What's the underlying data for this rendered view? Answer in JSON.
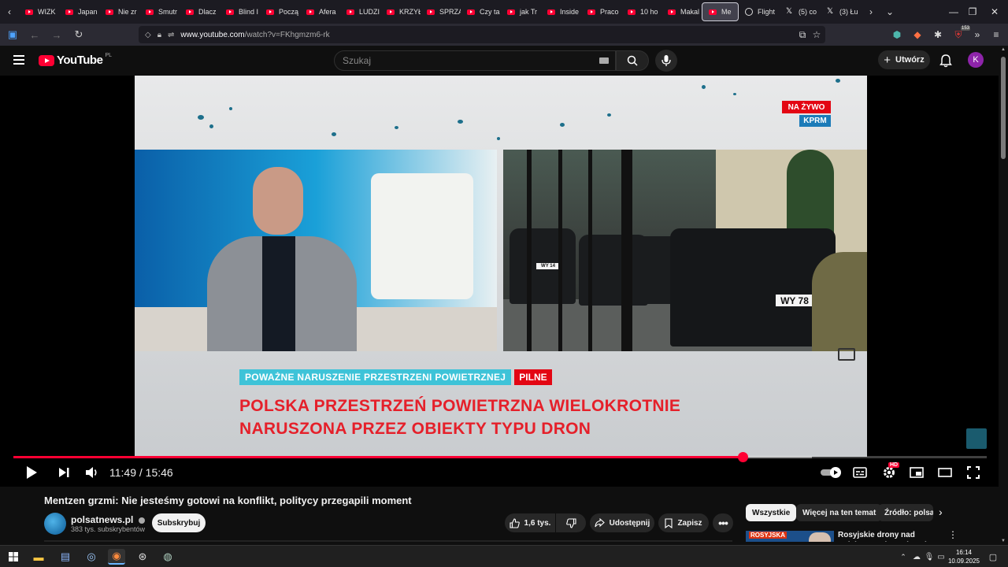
{
  "browser": {
    "tabs": [
      {
        "label": "WIZK"
      },
      {
        "label": "Japan"
      },
      {
        "label": "Nie zr"
      },
      {
        "label": "Smutr"
      },
      {
        "label": "Dlacz"
      },
      {
        "label": "Blind I"
      },
      {
        "label": "Począ"
      },
      {
        "label": "Afera"
      },
      {
        "label": "LUDZI"
      },
      {
        "label": "KRZYŁ"
      },
      {
        "label": "SPRZA"
      },
      {
        "label": "Czy ta"
      },
      {
        "label": "jak Tr"
      },
      {
        "label": "Inside"
      },
      {
        "label": "Praco"
      },
      {
        "label": "10 ho"
      },
      {
        "label": "Makal"
      }
    ],
    "active_tab": {
      "label": "Me"
    },
    "extra_tabs": [
      {
        "label": "Flight",
        "icon": "globe-icon"
      },
      {
        "label": "(5) co",
        "icon": "x-logo-icon"
      },
      {
        "label": "(3) Łu",
        "icon": "x-logo-icon"
      }
    ],
    "url_host": "www.youtube.com",
    "url_path": "/watch?v=FKhgmzm6-rk",
    "ext_badge": "153"
  },
  "youtube": {
    "logo_text": "YouTube",
    "country_code": "PL",
    "search_placeholder": "Szukaj",
    "create_label": "Utwórz",
    "avatar_letter": "K"
  },
  "video_frame": {
    "live_label": "NA ŻYWO",
    "source_label": "KPRM",
    "tag_label": "POWAŻNE NARUSZENIE PRZESTRZENI POWIETRZNEJ",
    "breaking_label": "PILNE",
    "headline_line1": "POLSKA PRZESTRZEŃ POWIETRZNA WIELOKROTNIE",
    "headline_line2": "NARUSZONA PRZEZ OBIEKTY TYPU DRON",
    "plate_text": "WY 78",
    "plate_small": "WY 14"
  },
  "player": {
    "current_time": "11:49",
    "duration": "15:46",
    "time_display": "11:49 / 15:46",
    "played_fraction": 0.749,
    "buffered_fraction": 0.82,
    "hd_badge": "HD"
  },
  "video_info": {
    "title": "Mentzen grzmi: Nie jesteśmy gotowi na konflikt, politycy przegapili moment",
    "channel_name": "polsatnews.pl",
    "subscribers": "383 tys. subskrybentów",
    "subscribe_label": "Subskrybuj",
    "likes": "1,6 tys.",
    "share_label": "Udostępnij",
    "save_label": "Zapisz"
  },
  "recommendations": {
    "chips": [
      "Wszystkie",
      "Więcej na ten temat",
      "Źródło: polsa"
    ],
    "first_thumb_tag": "ROSYJSKA",
    "first_title": "Rosyjskie drony nad Polską. Co się wydarzyło? Co chce"
  },
  "taskbar": {
    "time": "16:14",
    "date": "10.09.2025"
  }
}
